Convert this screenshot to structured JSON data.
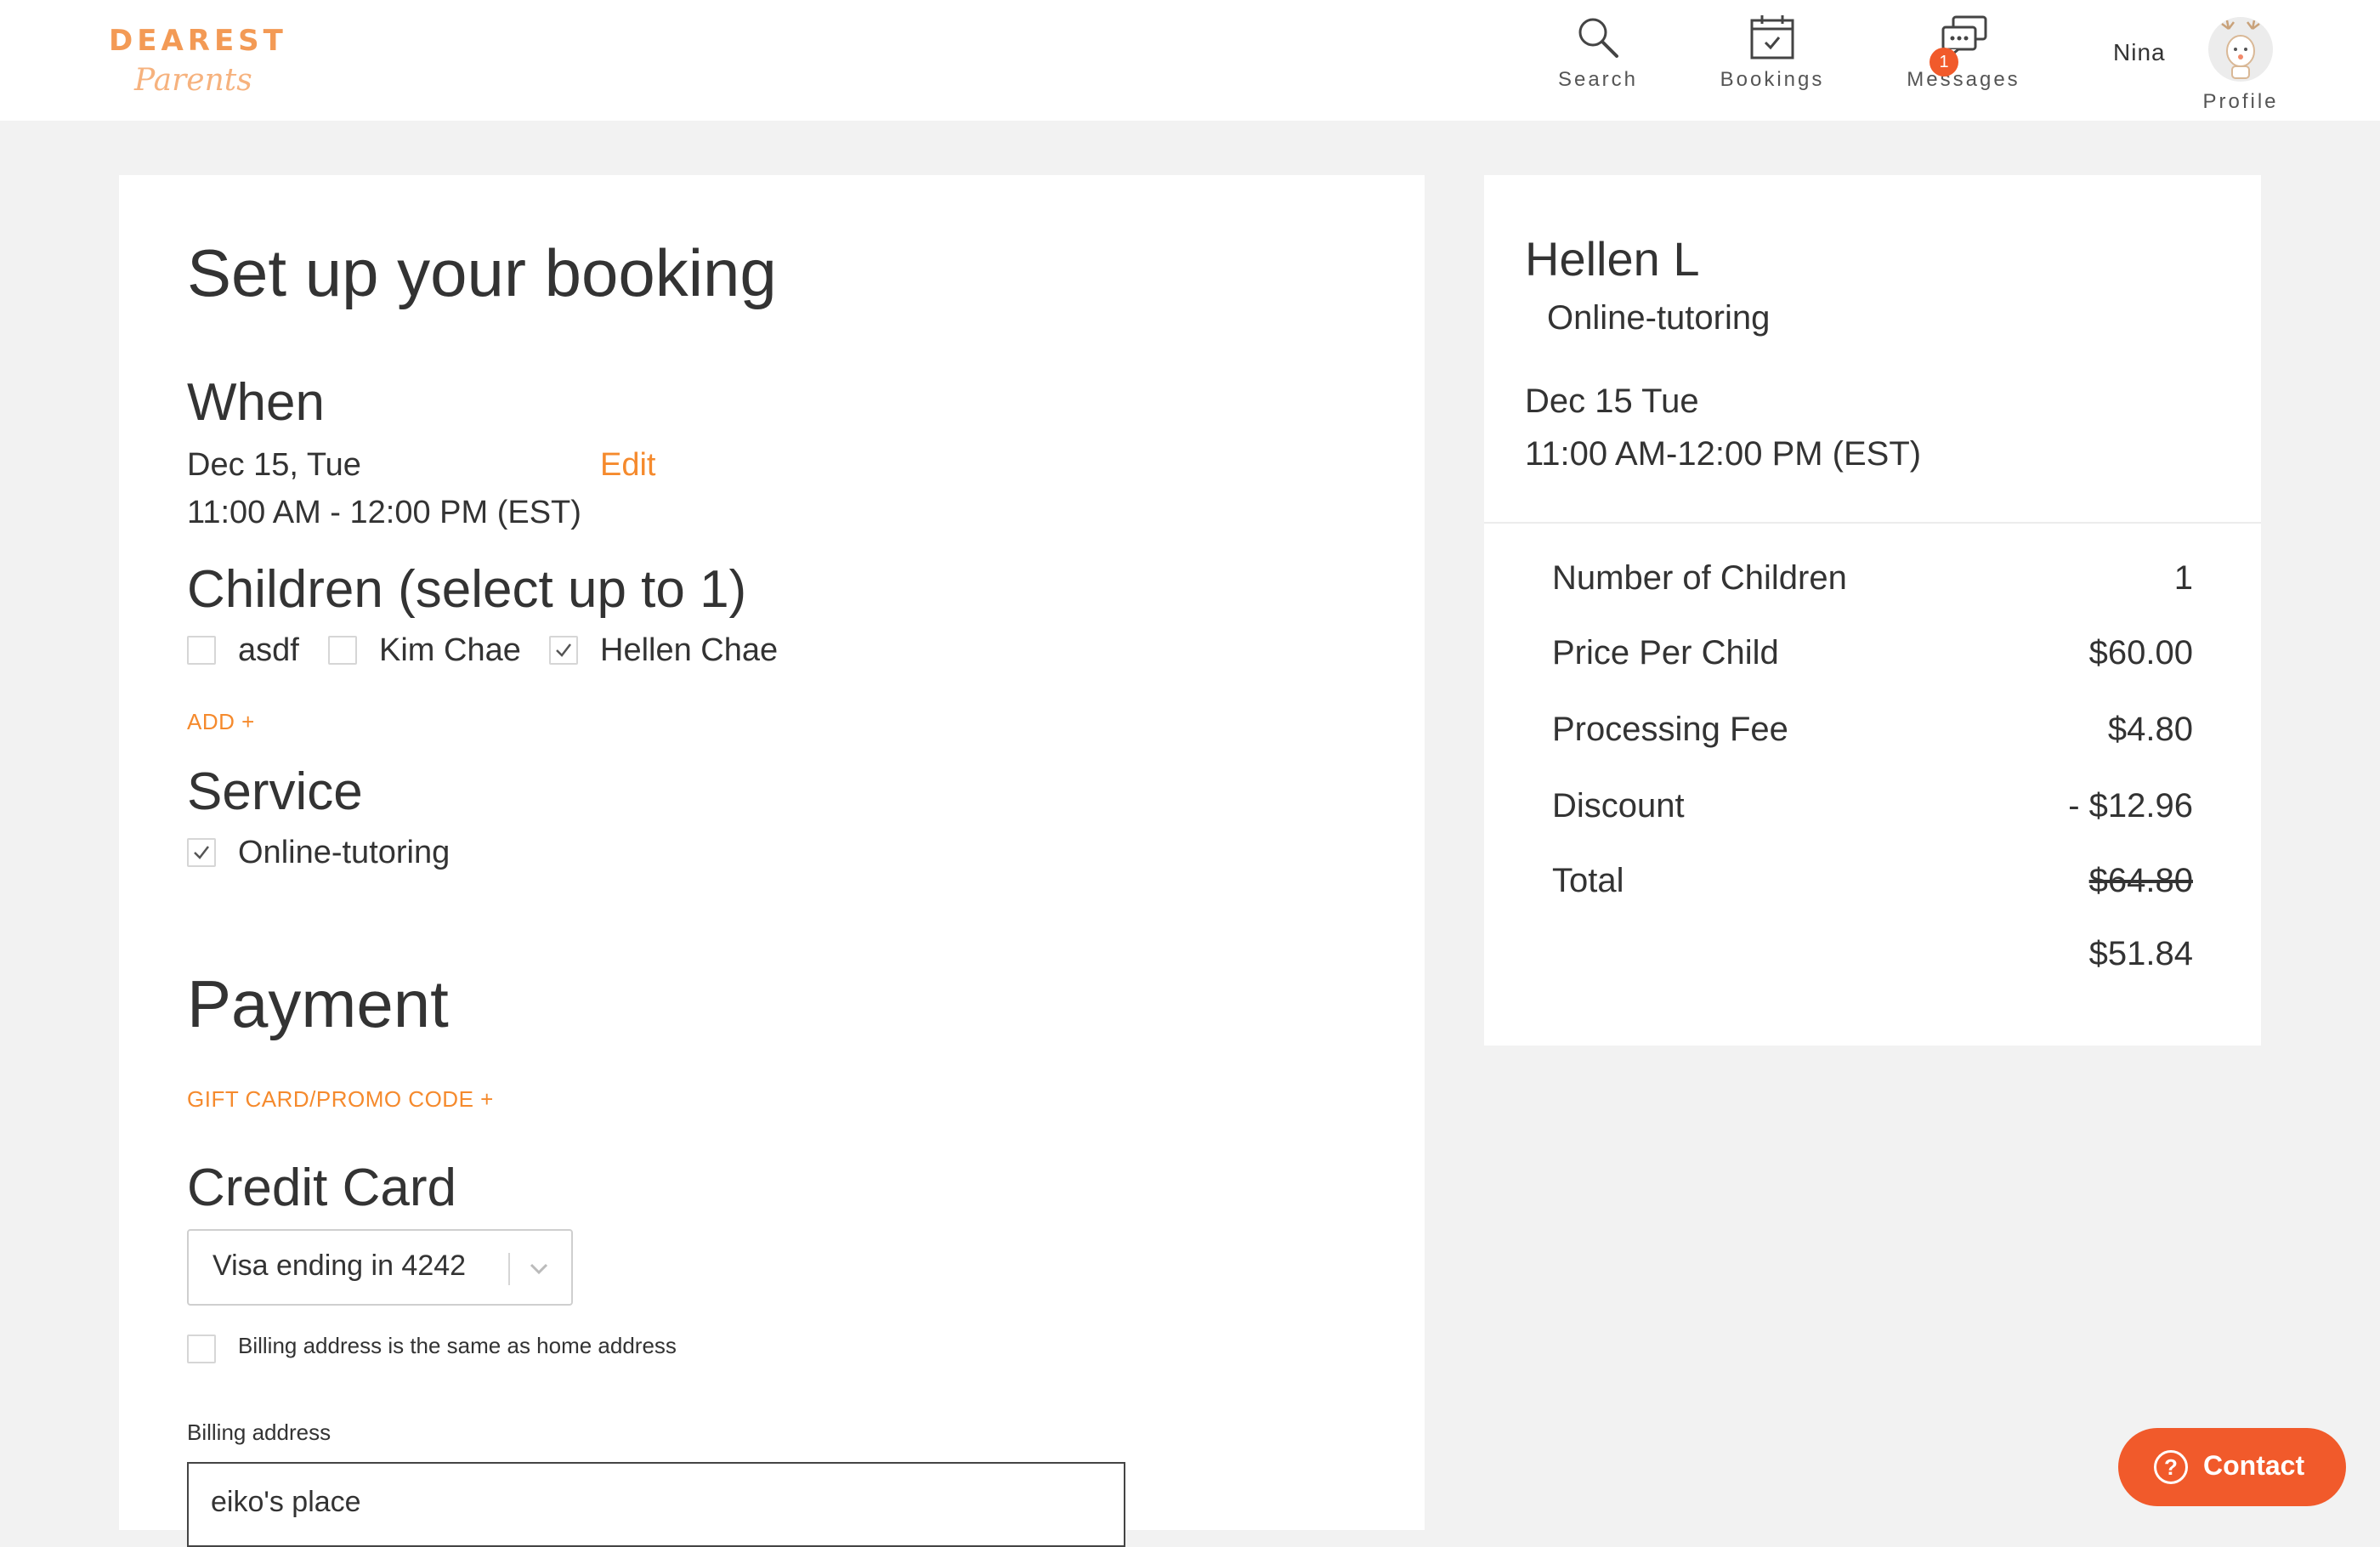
{
  "header": {
    "logo_top": "DEAREST",
    "logo_bottom": "Parents",
    "nav": {
      "search": "Search",
      "bookings": "Bookings",
      "messages": "Messages",
      "messages_badge": "1",
      "user_name": "Nina",
      "profile": "Profile"
    }
  },
  "booking": {
    "title": "Set up your booking",
    "when": {
      "heading": "When",
      "date": "Dec 15, Tue",
      "time": "11:00 AM - 12:00 PM (EST)",
      "edit": "Edit"
    },
    "children": {
      "heading": "Children (select up to 1)",
      "items": [
        {
          "label": "asdf",
          "checked": false
        },
        {
          "label": "Kim Chae",
          "checked": false
        },
        {
          "label": "Hellen Chae",
          "checked": true
        }
      ],
      "add": "ADD +"
    },
    "service": {
      "heading": "Service",
      "items": [
        {
          "label": "Online-tutoring",
          "checked": true
        }
      ]
    },
    "payment": {
      "heading": "Payment",
      "promo_link": "GIFT CARD/PROMO CODE +",
      "credit_card_heading": "Credit Card",
      "card_selected": "Visa ending in 4242",
      "billing_same_label": "Billing address is the same as home address",
      "billing_same_checked": false,
      "billing_label": "Billing address",
      "billing_value": "eiko's place"
    }
  },
  "summary": {
    "tutor": "Hellen L",
    "service": "Online-tutoring",
    "date": "Dec 15 Tue",
    "time": "11:00 AM-12:00 PM (EST)",
    "rows": [
      {
        "label": "Number of Children",
        "value": "1"
      },
      {
        "label": "Price Per Child",
        "value": "$60.00"
      },
      {
        "label": "Processing Fee",
        "value": "$4.80"
      },
      {
        "label": "Discount",
        "value": "- $12.96"
      },
      {
        "label": "Total",
        "value": "$64.80"
      }
    ],
    "final_total": "$51.84"
  },
  "contact": {
    "icon": "?",
    "label": "Contact"
  },
  "colors": {
    "accent": "#f58a2d",
    "contact": "#f15a2b",
    "logo": "#f39a55"
  }
}
